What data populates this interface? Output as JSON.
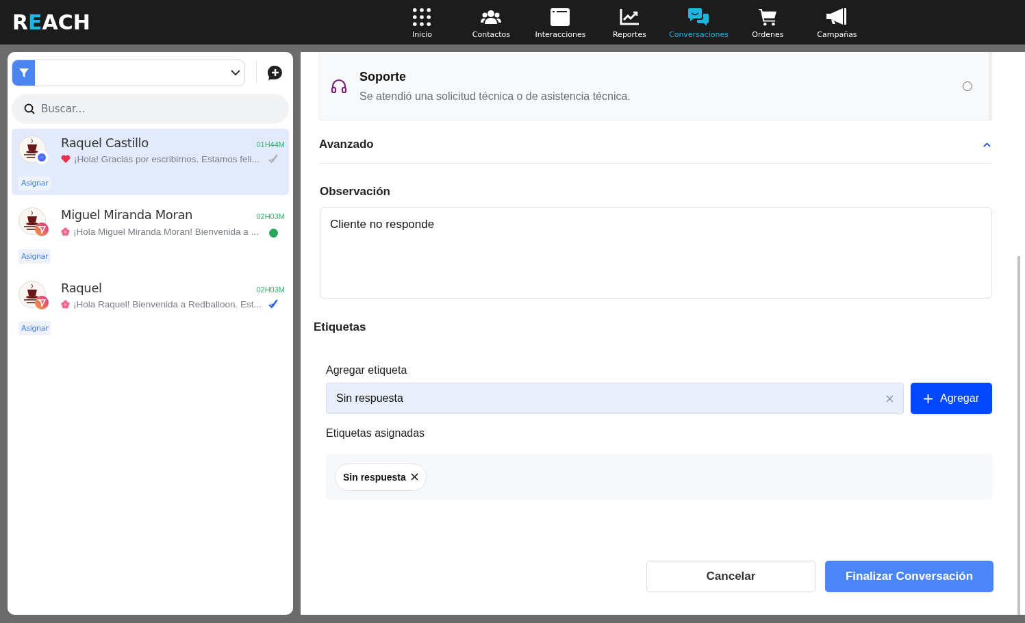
{
  "logo": "REACH",
  "nav": [
    {
      "label": "Inicio",
      "selected": false
    },
    {
      "label": "Contactos",
      "selected": false
    },
    {
      "label": "Interacciones",
      "selected": false
    },
    {
      "label": "Reportes",
      "selected": false
    },
    {
      "label": "Conversaciones",
      "selected": true
    },
    {
      "label": "Ordenes",
      "selected": false
    },
    {
      "label": "Campañas",
      "selected": false
    }
  ],
  "sidebar": {
    "search": {
      "placeholder": "Buscar..."
    },
    "conversations": [
      {
        "name": "Raquel Castillo",
        "time": "01H44M",
        "preview": "¡Hola! Gracias por escribirnos. Estamos feli...",
        "kind": "messenger",
        "online": false,
        "read": false,
        "assign": "Asignar",
        "selected": true
      },
      {
        "name": "Miguel Miranda Moran",
        "time": "02H03M",
        "preview": "¡Hola Miguel Miranda Moran! Bienvenida a ...",
        "kind": "instagram",
        "online": true,
        "assign": "Asignar",
        "selected": false
      },
      {
        "name": "Raquel",
        "time": "02H03M",
        "preview": "¡Hola Raquel! Bienvenida a Redballoon. Est...",
        "kind": "instagram",
        "online": false,
        "read": true,
        "assign": "Asignar",
        "selected": false
      }
    ]
  },
  "detail": {
    "option": {
      "title": "Soporte",
      "description": "Se atendió una solicitud técnica o de asistencia técnica.",
      "selected": false
    },
    "advanced": {
      "title": "Avanzado",
      "expanded": true
    },
    "observation": {
      "label": "Observación",
      "value": "Cliente no responde"
    },
    "tags": {
      "heading": "Etiquetas",
      "add_label": "Agregar etiqueta",
      "field_value": "Sin respuesta",
      "add_button": "Agregar",
      "assigned_label": "Etiquetas asignadas",
      "assigned": [
        {
          "label": "Sin respuesta"
        }
      ]
    },
    "buttons": [
      {
        "label": "Cancelar",
        "kind": "secondary"
      },
      {
        "label": "Finalizar Conversación",
        "kind": "primary"
      }
    ]
  }
}
